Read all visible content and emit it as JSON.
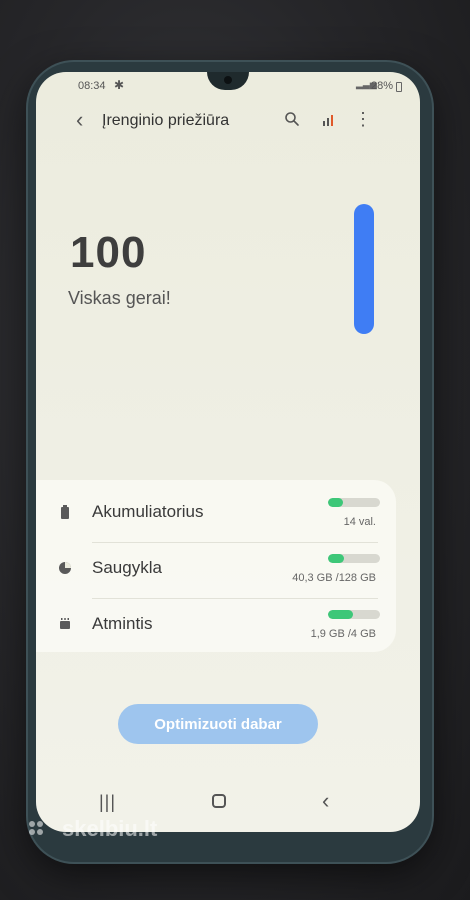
{
  "status_bar": {
    "time": "08:34",
    "battery": "28%"
  },
  "app_bar": {
    "title": "Įrenginio priežiūra"
  },
  "score": {
    "value": "100",
    "message": "Viskas gerai!"
  },
  "items": [
    {
      "label": "Akumuliatorius",
      "detail": "14 val.",
      "level": 0.28,
      "icon": "battery-icon"
    },
    {
      "label": "Saugykla",
      "detail": "40,3 GB /128 GB",
      "level": 0.31,
      "icon": "storage-pie-icon"
    },
    {
      "label": "Atmintis",
      "detail": "1,9 GB /4 GB",
      "level": 0.48,
      "icon": "memory-chip-icon"
    }
  ],
  "optimize_button": {
    "label": "Optimizuoti dabar"
  },
  "watermark": {
    "text": "skelbiu.lt"
  },
  "colors": {
    "accent": "#3f7df4",
    "meter": "#3dc778",
    "button": "#9ec5ee"
  }
}
